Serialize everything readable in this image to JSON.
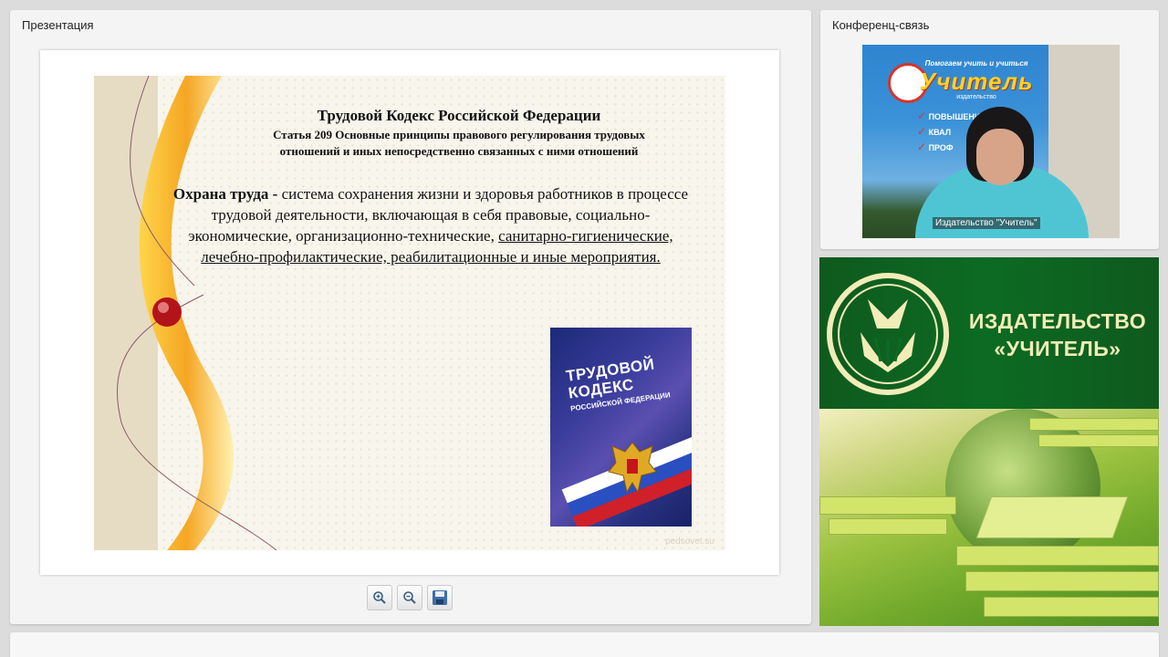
{
  "presentation": {
    "panel_title": "Презентация",
    "slide": {
      "title": "Трудовой Кодекс Российской Федерации",
      "subtitle_line1": "Статья 209 Основные принципы правового регулирования трудовых",
      "subtitle_line2": "отношений и иных непосредственно связанных с ними отношений",
      "term": "Охрана труда -",
      "body_plain": " система сохранения жизни и здоровья работников в процессе трудовой деятельности, включающая в себя правовые, социально-экономические, организационно-технические, ",
      "body_underlined": "санитарно-гигиенические, лечебно-профилактические, реабилитационные и иные мероприятия.",
      "book_title": "ТРУДОВОЙ КОДЕКС",
      "book_subtitle": "РОССИЙСКОЙ ФЕДЕРАЦИИ",
      "watermark": "pedsovet.su"
    },
    "toolbar": {
      "zoom_in_icon": "zoom-in-icon",
      "zoom_out_icon": "zoom-out-icon",
      "save_icon": "floppy-disk-icon"
    }
  },
  "conference": {
    "panel_title": "Конференц-связь",
    "webcam_caption": "Издательство \"Учитель\"",
    "banner_slogan": "Помогаем учить и учиться",
    "banner_name": "Учитель",
    "banner_sub": "издательство",
    "banner_points": [
      "ПОВЫШЕНИЕ",
      "КВАЛ",
      "ПРОФ"
    ]
  },
  "publisher_ad": {
    "name_line1": "ИЗДАТЕЛЬСТВО",
    "name_line2": "«УЧИТЕЛЬ»"
  },
  "colors": {
    "ad_green": "#0c6b22",
    "ad_text": "#f2ecb8",
    "deco_orange": "#f5a623"
  }
}
